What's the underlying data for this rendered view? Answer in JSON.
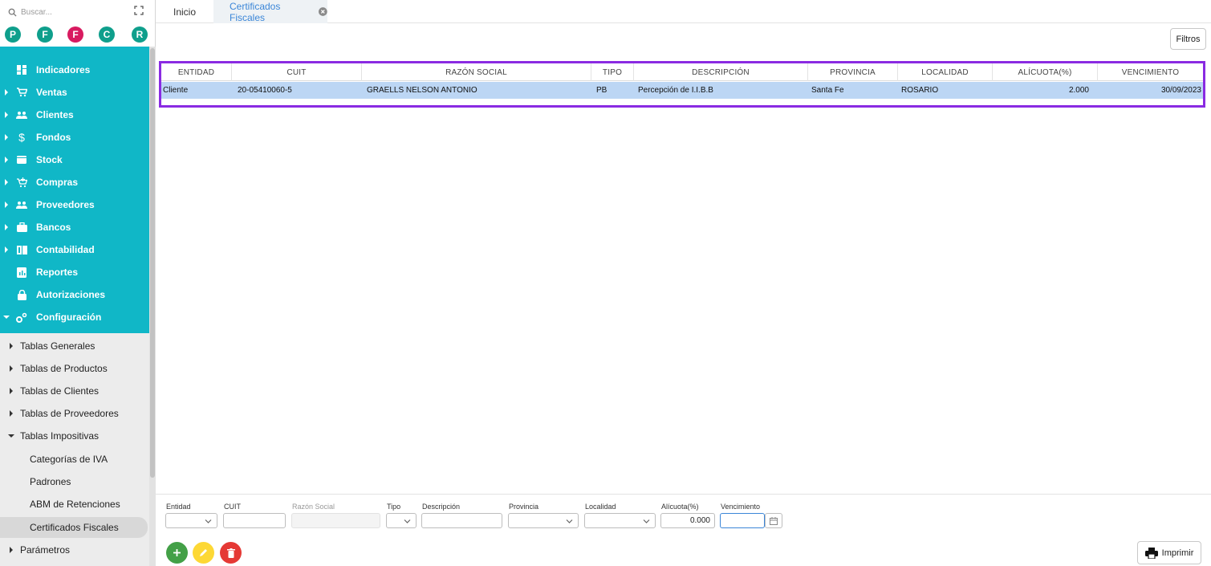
{
  "sidebar": {
    "search_placeholder": "Buscar...",
    "avatars": [
      {
        "letter": "P",
        "color": "#0f9f8c"
      },
      {
        "letter": "F",
        "color": "#0f9f8c"
      },
      {
        "letter": "F",
        "color": "#d81b60"
      },
      {
        "letter": "C",
        "color": "#0f9f8c"
      },
      {
        "letter": "R",
        "color": "#0f9f8c"
      }
    ],
    "nav": [
      {
        "label": "Indicadores",
        "icon": "dashboard-icon",
        "expandable": false
      },
      {
        "label": "Ventas",
        "icon": "cart-icon",
        "expandable": true
      },
      {
        "label": "Clientes",
        "icon": "people-icon",
        "expandable": true
      },
      {
        "label": "Fondos",
        "icon": "dollar-icon",
        "expandable": true
      },
      {
        "label": "Stock",
        "icon": "box-icon",
        "expandable": true
      },
      {
        "label": "Compras",
        "icon": "cart-add-icon",
        "expandable": true
      },
      {
        "label": "Proveedores",
        "icon": "people-icon",
        "expandable": true
      },
      {
        "label": "Bancos",
        "icon": "briefcase-icon",
        "expandable": true
      },
      {
        "label": "Contabilidad",
        "icon": "book-icon",
        "expandable": true
      },
      {
        "label": "Reportes",
        "icon": "report-icon",
        "expandable": false
      },
      {
        "label": "Autorizaciones",
        "icon": "lock-icon",
        "expandable": false
      },
      {
        "label": "Configuración",
        "icon": "gears-icon",
        "expandable": true,
        "expanded": true
      }
    ],
    "sub": [
      {
        "label": "Tablas Generales"
      },
      {
        "label": "Tablas de Productos"
      },
      {
        "label": "Tablas de Clientes"
      },
      {
        "label": "Tablas de Proveedores"
      },
      {
        "label": "Tablas Impositivas",
        "expanded": true
      }
    ],
    "children": [
      {
        "label": "Categorías de IVA"
      },
      {
        "label": "Padrones"
      },
      {
        "label": "ABM de Retenciones"
      },
      {
        "label": "Certificados Fiscales",
        "active": true
      }
    ],
    "last": {
      "label": "Parámetros"
    },
    "teal_color": "#10b7c7"
  },
  "tabs": {
    "home": "Inicio",
    "active": "Certificados Fiscales"
  },
  "toolbar": {
    "filtros": "Filtros"
  },
  "grid": {
    "columns": [
      "ENTIDAD",
      "CUIT",
      "RAZÓN SOCIAL",
      "TIPO",
      "DESCRIPCIÓN",
      "PROVINCIA",
      "LOCALIDAD",
      "ALÍCUOTA(%)",
      "VENCIMIENTO"
    ],
    "rows": [
      [
        "Cliente",
        "20-05410060-5",
        "GRAELLS NELSON ANTONIO",
        "PB",
        "Percepción de I.I.B.B",
        "Santa Fe",
        "ROSARIO",
        "2.000",
        "30/09/2023"
      ]
    ],
    "selected_color": "#bcd6f4",
    "border_color": "#8a2be2"
  },
  "editor": {
    "labels": {
      "entidad": "Entidad",
      "cuit": "CUIT",
      "razon": "Razón Social",
      "tipo": "Tipo",
      "descripcion": "Descripción",
      "provincia": "Provincia",
      "localidad": "Localidad",
      "alicuota": "Alícuota(%)",
      "vencimiento": "Vencimiento"
    },
    "values": {
      "alicuota": "0.000"
    }
  },
  "actions": {
    "add_color": "#43a047",
    "edit_color": "#fdd835",
    "delete_color": "#e53935",
    "imprimir": "Imprimir"
  }
}
